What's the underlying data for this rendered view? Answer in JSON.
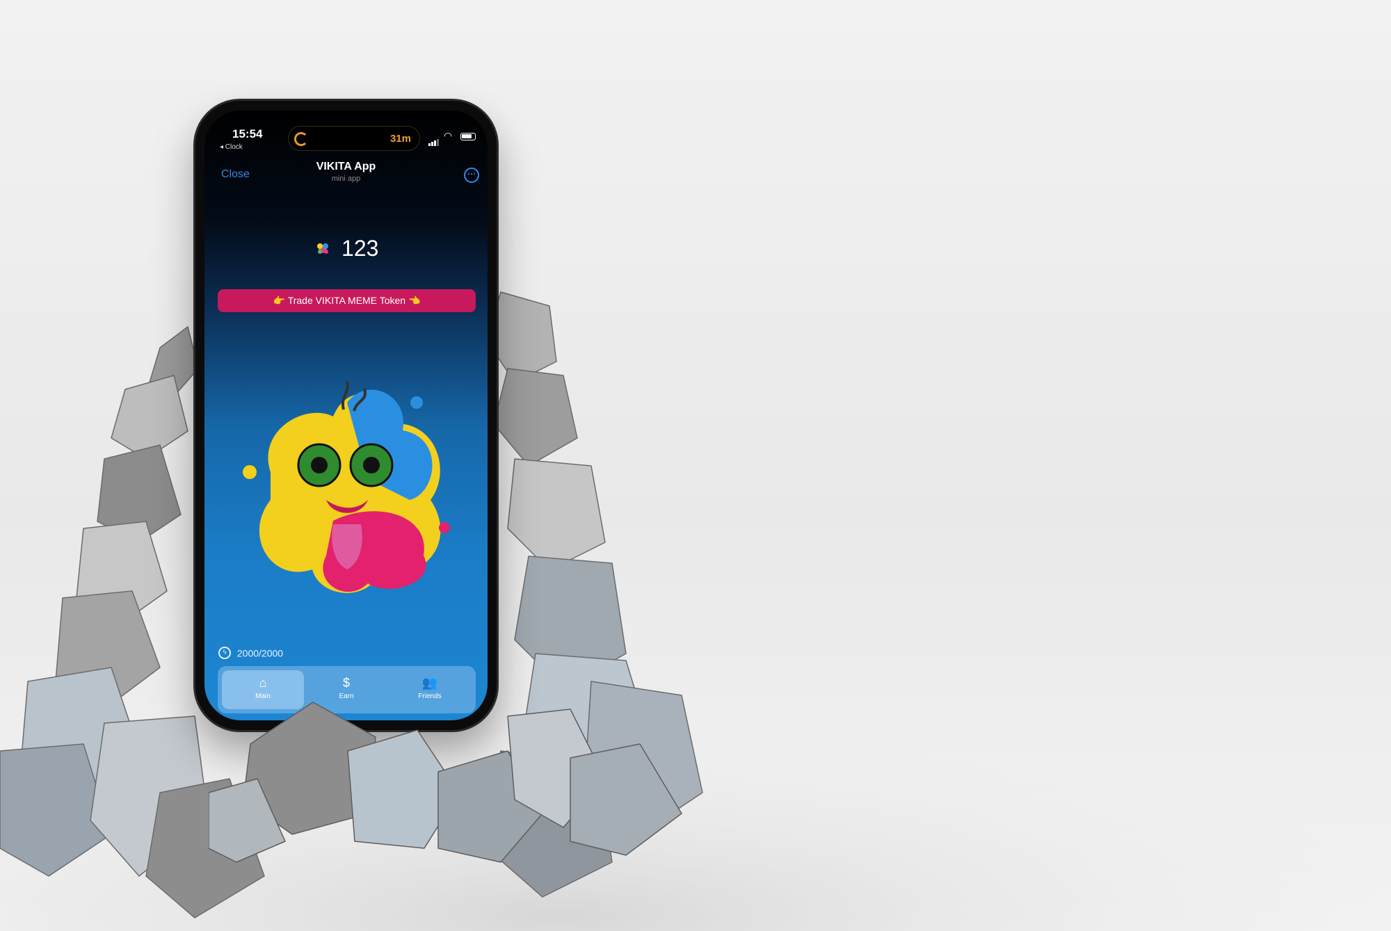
{
  "status_bar": {
    "time": "15:54",
    "back_app": "◂ Clock",
    "timer": "31m"
  },
  "header": {
    "close_label": "Close",
    "title": "VIKITA App",
    "subtitle": "mini app",
    "more_icon": "more-icon"
  },
  "balance": {
    "value": "123",
    "icon": "coin-icon"
  },
  "trade_button": {
    "label": "👉 Trade VIKITA MEME Token 👈"
  },
  "energy": {
    "value": "2000/2000",
    "icon": "lightning-icon"
  },
  "tabs": [
    {
      "label": "Main",
      "icon": "home-icon",
      "active": true
    },
    {
      "label": "Earn",
      "icon": "dollar-icon",
      "active": false
    },
    {
      "label": "Friends",
      "icon": "friends-icon",
      "active": false
    }
  ],
  "colors": {
    "accent": "#3b86e8",
    "trade_button": "#c8195c",
    "screen_bottom": "#1d86d2"
  }
}
